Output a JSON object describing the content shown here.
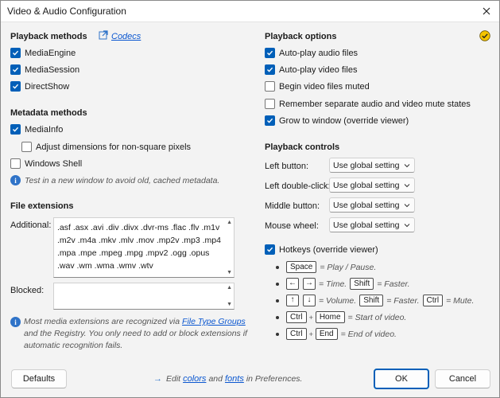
{
  "window": {
    "title": "Video & Audio Configuration"
  },
  "playback_methods": {
    "heading": "Playback methods",
    "codecs_link": "Codecs",
    "items": [
      {
        "label": "MediaEngine",
        "checked": true
      },
      {
        "label": "MediaSession",
        "checked": true
      },
      {
        "label": "DirectShow",
        "checked": true
      }
    ]
  },
  "metadata_methods": {
    "heading": "Metadata methods",
    "items": [
      {
        "label": "MediaInfo",
        "checked": true
      },
      {
        "label": "Adjust dimensions for non-square pixels",
        "checked": false
      },
      {
        "label": "Windows Shell",
        "checked": false
      }
    ],
    "hint": "Test in a new window to avoid old, cached metadata."
  },
  "file_extensions": {
    "heading": "File extensions",
    "additional_label": "Additional:",
    "additional_value": ".asf .asx .avi .div .divx .dvr-ms .flac .flv .m1v .m2v .m4a .mkv .mlv .mov .mp2v .mp3 .mp4 .mpa .mpe .mpeg .mpg .mpv2 .ogg .opus .wav .wm .wma .wmv .wtv",
    "blocked_label": "Blocked:",
    "blocked_value": "",
    "note_prefix": "Most media extensions are recognized via",
    "note_link": "File Type Groups",
    "note_suffix": "and the Registry. You only need to add or block extensions if automatic recognition fails."
  },
  "playback_options": {
    "heading": "Playback options",
    "items": [
      {
        "label": "Auto-play audio files",
        "checked": true
      },
      {
        "label": "Auto-play video files",
        "checked": true
      },
      {
        "label": "Begin video files muted",
        "checked": false
      },
      {
        "label": "Remember separate audio and video mute states",
        "checked": false
      },
      {
        "label": "Grow to window (override viewer)",
        "checked": true
      }
    ]
  },
  "playback_controls": {
    "heading": "Playback controls",
    "rows": [
      {
        "label": "Left button:",
        "value": "Use global setting"
      },
      {
        "label": "Left double-click:",
        "value": "Use global setting"
      },
      {
        "label": "Middle button:",
        "value": "Use global setting"
      },
      {
        "label": "Mouse wheel:",
        "value": "Use global setting"
      }
    ]
  },
  "hotkeys": {
    "label": "Hotkeys (override viewer)",
    "checked": true,
    "space_key": "Space",
    "space_desc": "= Play / Pause.",
    "time_desc": "= Time.",
    "shift_key": "Shift",
    "faster_desc": "= Faster.",
    "volume_desc": "= Volume.",
    "ctrl_key": "Ctrl",
    "mute_desc": "= Mute.",
    "home_key": "Home",
    "start_desc": "= Start of video.",
    "end_key": "End",
    "end_desc": "= End of video.",
    "plus": "+"
  },
  "footer": {
    "defaults": "Defaults",
    "edit_prefix": "Edit",
    "colors_link": "colors",
    "and": "and",
    "fonts_link": "fonts",
    "in_prefs": "in Preferences.",
    "ok": "OK",
    "cancel": "Cancel"
  },
  "colors": {
    "accent": "#005fb8",
    "link": "#0b57d0",
    "status": "#f5c400"
  }
}
